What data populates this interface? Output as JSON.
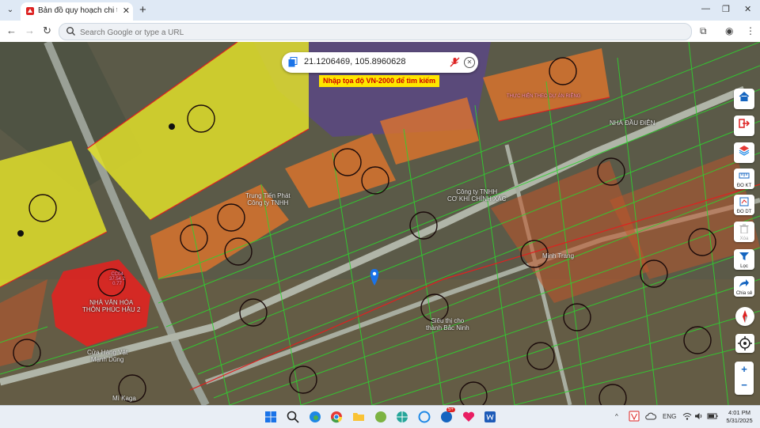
{
  "browser": {
    "tab_title": "Bản đồ quy hoạch chi tiết Đông",
    "new_tab_symbol": "+",
    "close_symbol": "✕",
    "omnibox_placeholder": "Search Google or type a URL"
  },
  "search": {
    "coordinates": "21.1206469, 105.8960628",
    "hint": "Nhập tọa độ VN-2000 để tìm kiếm"
  },
  "map_labels": {
    "culture_house": "NHÀ VĂN HÓA\nTHÔN PHÚC HẬU 2",
    "company_a": "Công ty TNHH\nCƠ KHÍ CHÍNH XÁC",
    "trung_tien": "Trung Tiến Phát\nCông ty TNHH",
    "supermarket": "Siêu thị cho\nthành Bắc Ninh",
    "nha_dau_dien": "NHÀ ĐẦU ĐIỆN",
    "thuc_hien": "THỰC HIỆN THEO DỰ ÁN RIÊNG",
    "cua_hang": "Cửa Hàng Vật\nMạnh Dũng",
    "mi_kaga": "Mì Kaga",
    "minh_trang": "Minh Trang",
    "cc_code": "CC04\n37.54 2\n0.77"
  },
  "map_controls": {
    "do_kt": "ĐO KT",
    "do_dt": "ĐO DT",
    "xoa": "Xóa",
    "loc": "Lọc",
    "chia_se": "Chia sẻ",
    "zoom_in": "+",
    "zoom_out": "−"
  },
  "taskbar": {
    "language": "ENG",
    "time": "4:01 PM",
    "date": "5/31/2025",
    "notification_count": "5+"
  },
  "colors": {
    "yellow_zone": "#e0df2a",
    "orange_zone": "#e8772a",
    "red_zone": "#e8201e",
    "parcel_lines": "#2fd12f",
    "boundary": "#e02020",
    "accent": "#1a73e8"
  }
}
